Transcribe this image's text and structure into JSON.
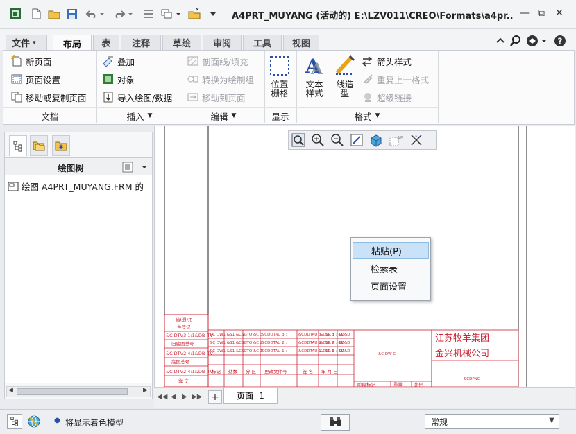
{
  "window": {
    "title": "A4PRT_MUYANG (活动的) E:\\LZV011\\CREO\\Formats\\a4pr..",
    "minimize": "—",
    "restore": "⧉",
    "close": "✕"
  },
  "ribbon_tabs": [
    {
      "label": "文件"
    },
    {
      "label": "布局"
    },
    {
      "label": "表"
    },
    {
      "label": "注释"
    },
    {
      "label": "草绘"
    },
    {
      "label": "审阅"
    },
    {
      "label": "工具"
    },
    {
      "label": "视图"
    }
  ],
  "ribbon": {
    "doc": {
      "new_page": "新页面",
      "page_setup": "页面设置",
      "move_copy_page": "移动或复制页面",
      "label": "文档"
    },
    "insert": {
      "overlay": "叠加",
      "object": "对象",
      "import": "导入绘图/数据",
      "label": "插入"
    },
    "edit": {
      "hatch": "剖面线/填充",
      "convert": "转换为绘制组",
      "move_to_page": "移动到页面",
      "label": "编辑"
    },
    "display": {
      "position_grid": "位置\n栅格",
      "label": "显示"
    },
    "format": {
      "text_style": "文本\n样式",
      "line_style": "线造\n型",
      "arrow_style": "箭头样式",
      "repeat_last": "重复上一格式",
      "hyperlink": "超级链接",
      "label": "格式"
    }
  },
  "left_panel": {
    "tree_title": "绘图树",
    "tree_item": "绘图 A4PRT_MUYANG.FRM 的"
  },
  "drawing": {
    "company_line1": "江苏牧羊集团",
    "company_line2": "金兴机械公司"
  },
  "context_menu": {
    "items": [
      {
        "label": "粘贴(P)"
      },
      {
        "label": "检索表"
      },
      {
        "label": "页面设置"
      }
    ]
  },
  "page_bar": {
    "page_label": "页面",
    "page_number": "1",
    "add_page": "+"
  },
  "status": {
    "message": "将显示着色模型",
    "filter_value": "常规"
  }
}
